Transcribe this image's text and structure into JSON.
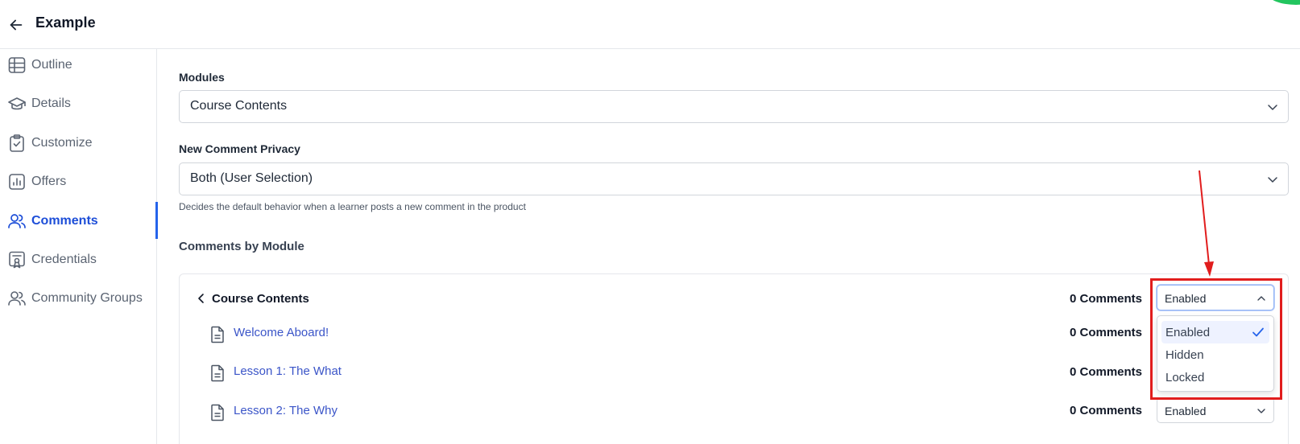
{
  "app": {
    "title": "Example"
  },
  "sidebar": {
    "items": [
      {
        "label": "Outline",
        "icon": "grid-icon"
      },
      {
        "label": "Details",
        "icon": "graduation-cap-icon"
      },
      {
        "label": "Customize",
        "icon": "clipboard-check-icon"
      },
      {
        "label": "Offers",
        "icon": "bar-chart-icon"
      },
      {
        "label": "Comments",
        "icon": "users-icon",
        "active": true
      },
      {
        "label": "Credentials",
        "icon": "certificate-icon"
      },
      {
        "label": "Community Groups",
        "icon": "users-icon"
      }
    ]
  },
  "form": {
    "modules_label": "Modules",
    "modules_value": "Course Contents",
    "privacy_label": "New Comment Privacy",
    "privacy_value": "Both (User Selection)",
    "privacy_hint": "Decides the default behavior when a learner posts a new comment in the product",
    "section_title": "Comments by Module"
  },
  "module": {
    "name": "Course Contents",
    "count": "0 Comments",
    "status": "Enabled",
    "lessons": [
      {
        "title": "Welcome Aboard!",
        "count": "0 Comments"
      },
      {
        "title": "Lesson 1: The What",
        "count": "0 Comments"
      },
      {
        "title": "Lesson 2: The Why",
        "count": "0 Comments",
        "status": "Enabled"
      }
    ]
  },
  "dropdown": {
    "options": [
      "Enabled",
      "Hidden",
      "Locked"
    ],
    "selected": "Enabled"
  },
  "colors": {
    "accent": "#2563eb",
    "link": "#3b55c8",
    "annotation": "#e11d1d",
    "corner": "#22c55e"
  }
}
